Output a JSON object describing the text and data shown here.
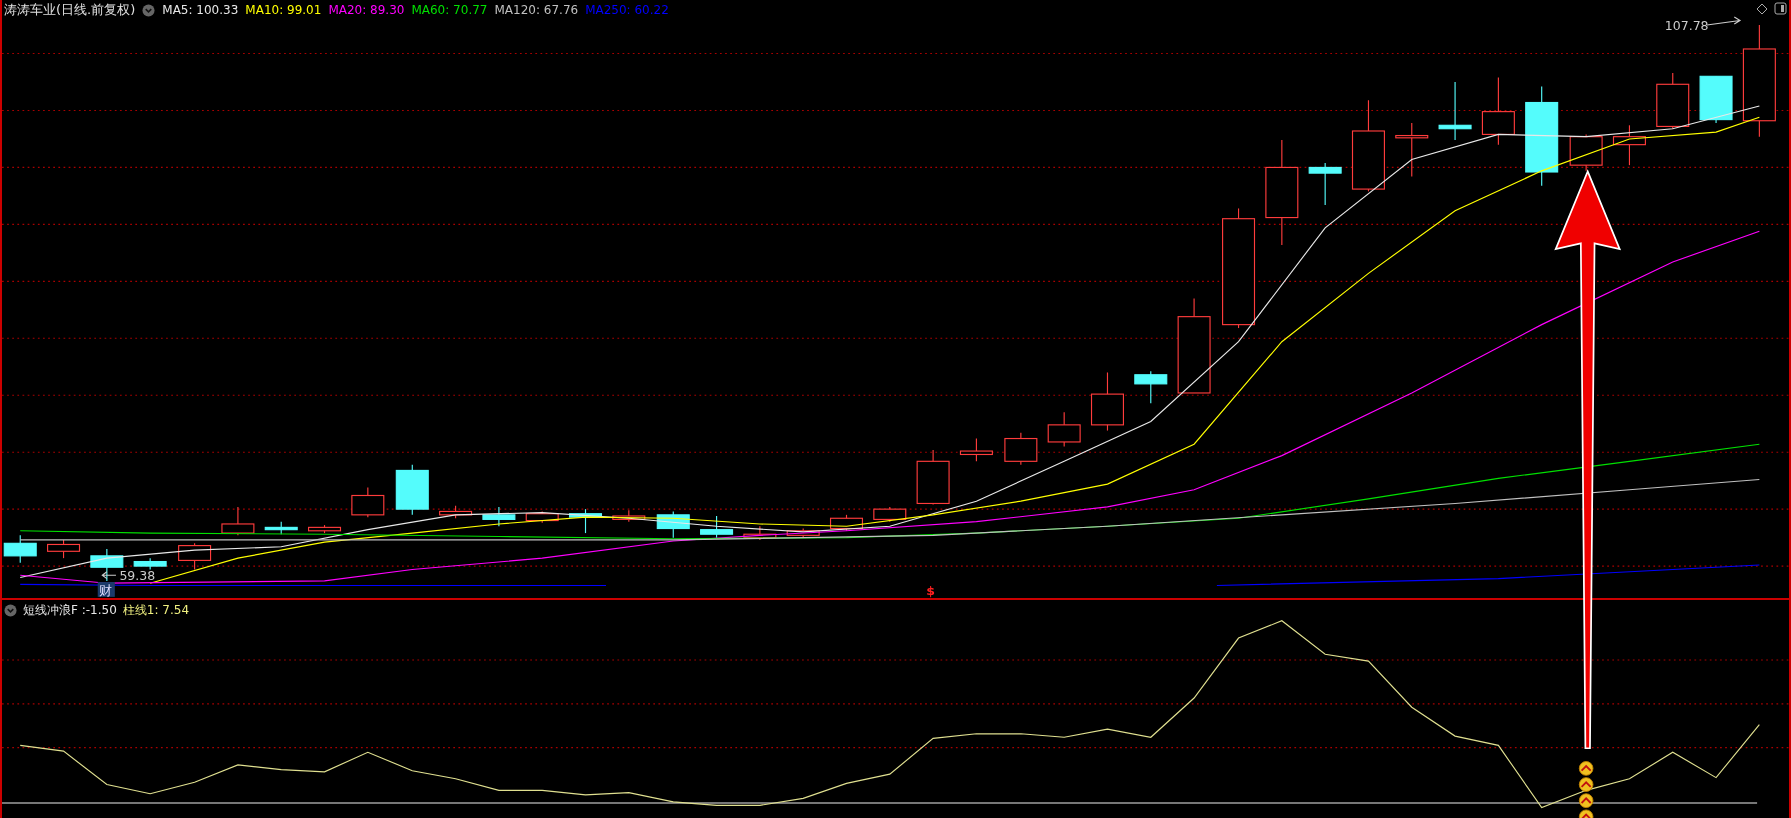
{
  "title": "涛涛车业(日线.前复权)",
  "ma_legend": [
    {
      "label": "MA5: 100.33",
      "color": "#e8e8e8"
    },
    {
      "label": "MA10: 99.01",
      "color": "#ffff00"
    },
    {
      "label": "MA20: 89.30",
      "color": "#ff00ff"
    },
    {
      "label": "MA60: 70.77",
      "color": "#00e000"
    },
    {
      "label": "MA120: 67.76",
      "color": "#c0c0c0"
    },
    {
      "label": "MA250: 60.22",
      "color": "#0000ff"
    }
  ],
  "high_label": "107.78",
  "low_label": "59.38",
  "finance_marker": "财",
  "dividend_marker": "$",
  "indicator": {
    "name": "短线冲浪F :-1.50",
    "readout": "柱线1: 7.54"
  }
}
